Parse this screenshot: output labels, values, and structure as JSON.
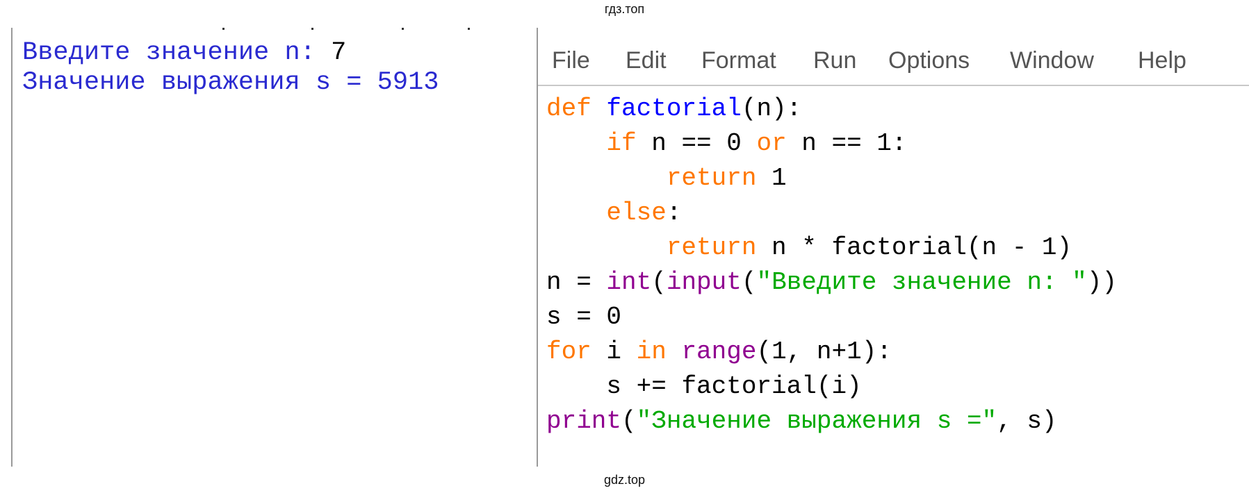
{
  "watermark": {
    "top": "гдз.топ",
    "bottom": "gdz.top"
  },
  "shell": {
    "lines": [
      {
        "prompt": "Введите значение n: ",
        "value": "7"
      },
      {
        "prompt": "Значение выражения s = 5913",
        "value": ""
      }
    ]
  },
  "editor": {
    "menu": [
      "File",
      "Edit",
      "Format",
      "Run",
      "Options",
      "Window",
      "Help"
    ],
    "code": {
      "l1": {
        "a": "def",
        "b": " ",
        "c": "factorial",
        "d": "(n):"
      },
      "l2": {
        "i": "    ",
        "a": "if",
        "b": " n == 0 ",
        "c": "or",
        "d": " n == 1:"
      },
      "l3": {
        "i": "        ",
        "a": "return",
        "b": " 1"
      },
      "l4": {
        "i": "    ",
        "a": "else",
        "b": ":"
      },
      "l5": {
        "i": "        ",
        "a": "return",
        "b": " n * factorial(n - 1)"
      },
      "l6": {
        "a": "n = ",
        "b": "int",
        "c": "(",
        "d": "input",
        "e": "(",
        "f": "\"Введите значение n: \"",
        "g": "))"
      },
      "l7": {
        "a": "s = 0"
      },
      "l8": {
        "a": "for",
        "b": " i ",
        "c": "in",
        "d": " ",
        "e": "range",
        "f": "(1, n+1):"
      },
      "l9": {
        "i": "    ",
        "a": "s += factorial(i)"
      },
      "l10": {
        "a": "print",
        "b": "(",
        "c": "\"Значение выражения s =\"",
        "d": ", s)"
      }
    }
  },
  "colors": {
    "keyword": "#ff7700",
    "definition": "#0000ff",
    "builtin": "#900090",
    "string": "#00aa00",
    "shell_output": "#2a2ad0"
  }
}
